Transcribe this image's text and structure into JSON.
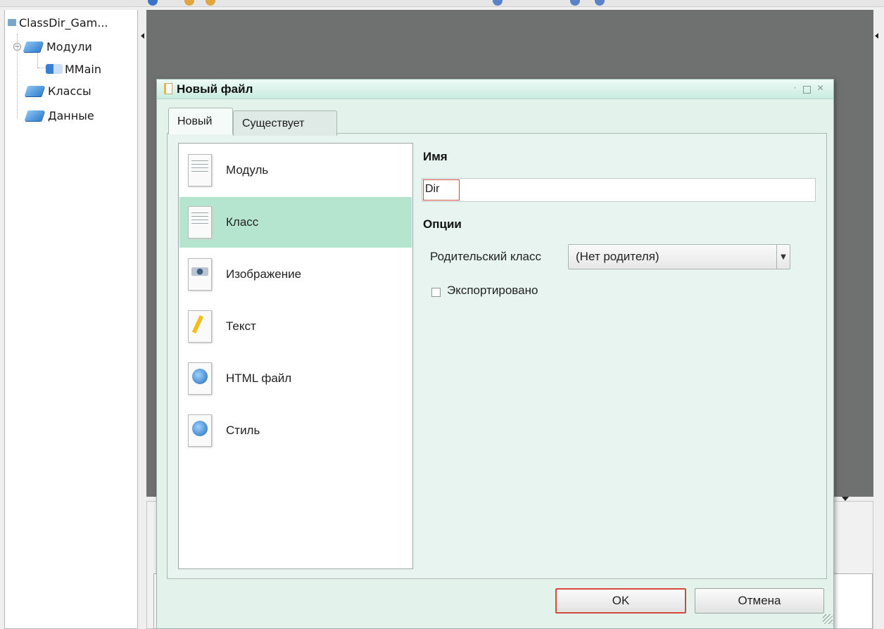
{
  "project_tree": {
    "root": "ClassDir_Gam...",
    "items": [
      {
        "label": "Модули",
        "icon": "folder-book-icon"
      },
      {
        "label": "MMain",
        "icon": "module-icon"
      },
      {
        "label": "Классы",
        "icon": "folder-book-icon"
      },
      {
        "label": "Данные",
        "icon": "folder-book-icon"
      }
    ]
  },
  "dialog": {
    "title": "Новый файл",
    "tabs": [
      {
        "label": "Новый",
        "active": true
      },
      {
        "label": "Существует",
        "active": false
      }
    ],
    "file_types": [
      {
        "label": "Модуль",
        "icon": "document-icon",
        "selected": false
      },
      {
        "label": "Класс",
        "icon": "class-document-icon",
        "selected": true
      },
      {
        "label": "Изображение",
        "icon": "image-file-icon",
        "selected": false
      },
      {
        "label": "Текст",
        "icon": "text-pencil-icon",
        "selected": false
      },
      {
        "label": "HTML файл",
        "icon": "globe-file-icon",
        "selected": false
      },
      {
        "label": "Стиль",
        "icon": "globe-file-icon",
        "selected": false
      }
    ],
    "name_section": "Имя",
    "name_value": "Dir",
    "options_section": "Опции",
    "parent_label": "Родительский класс",
    "parent_value": "(Нет родителя)",
    "exported_label": "Экспортировано",
    "exported_checked": false,
    "ok_label": "OK",
    "cancel_label": "Отмена"
  },
  "colors": {
    "dialog_bg": "#e4f2ec",
    "selected_item": "#b5e5cf",
    "editor_bg": "#6f7170",
    "focus_outline": "#d24a3a"
  }
}
